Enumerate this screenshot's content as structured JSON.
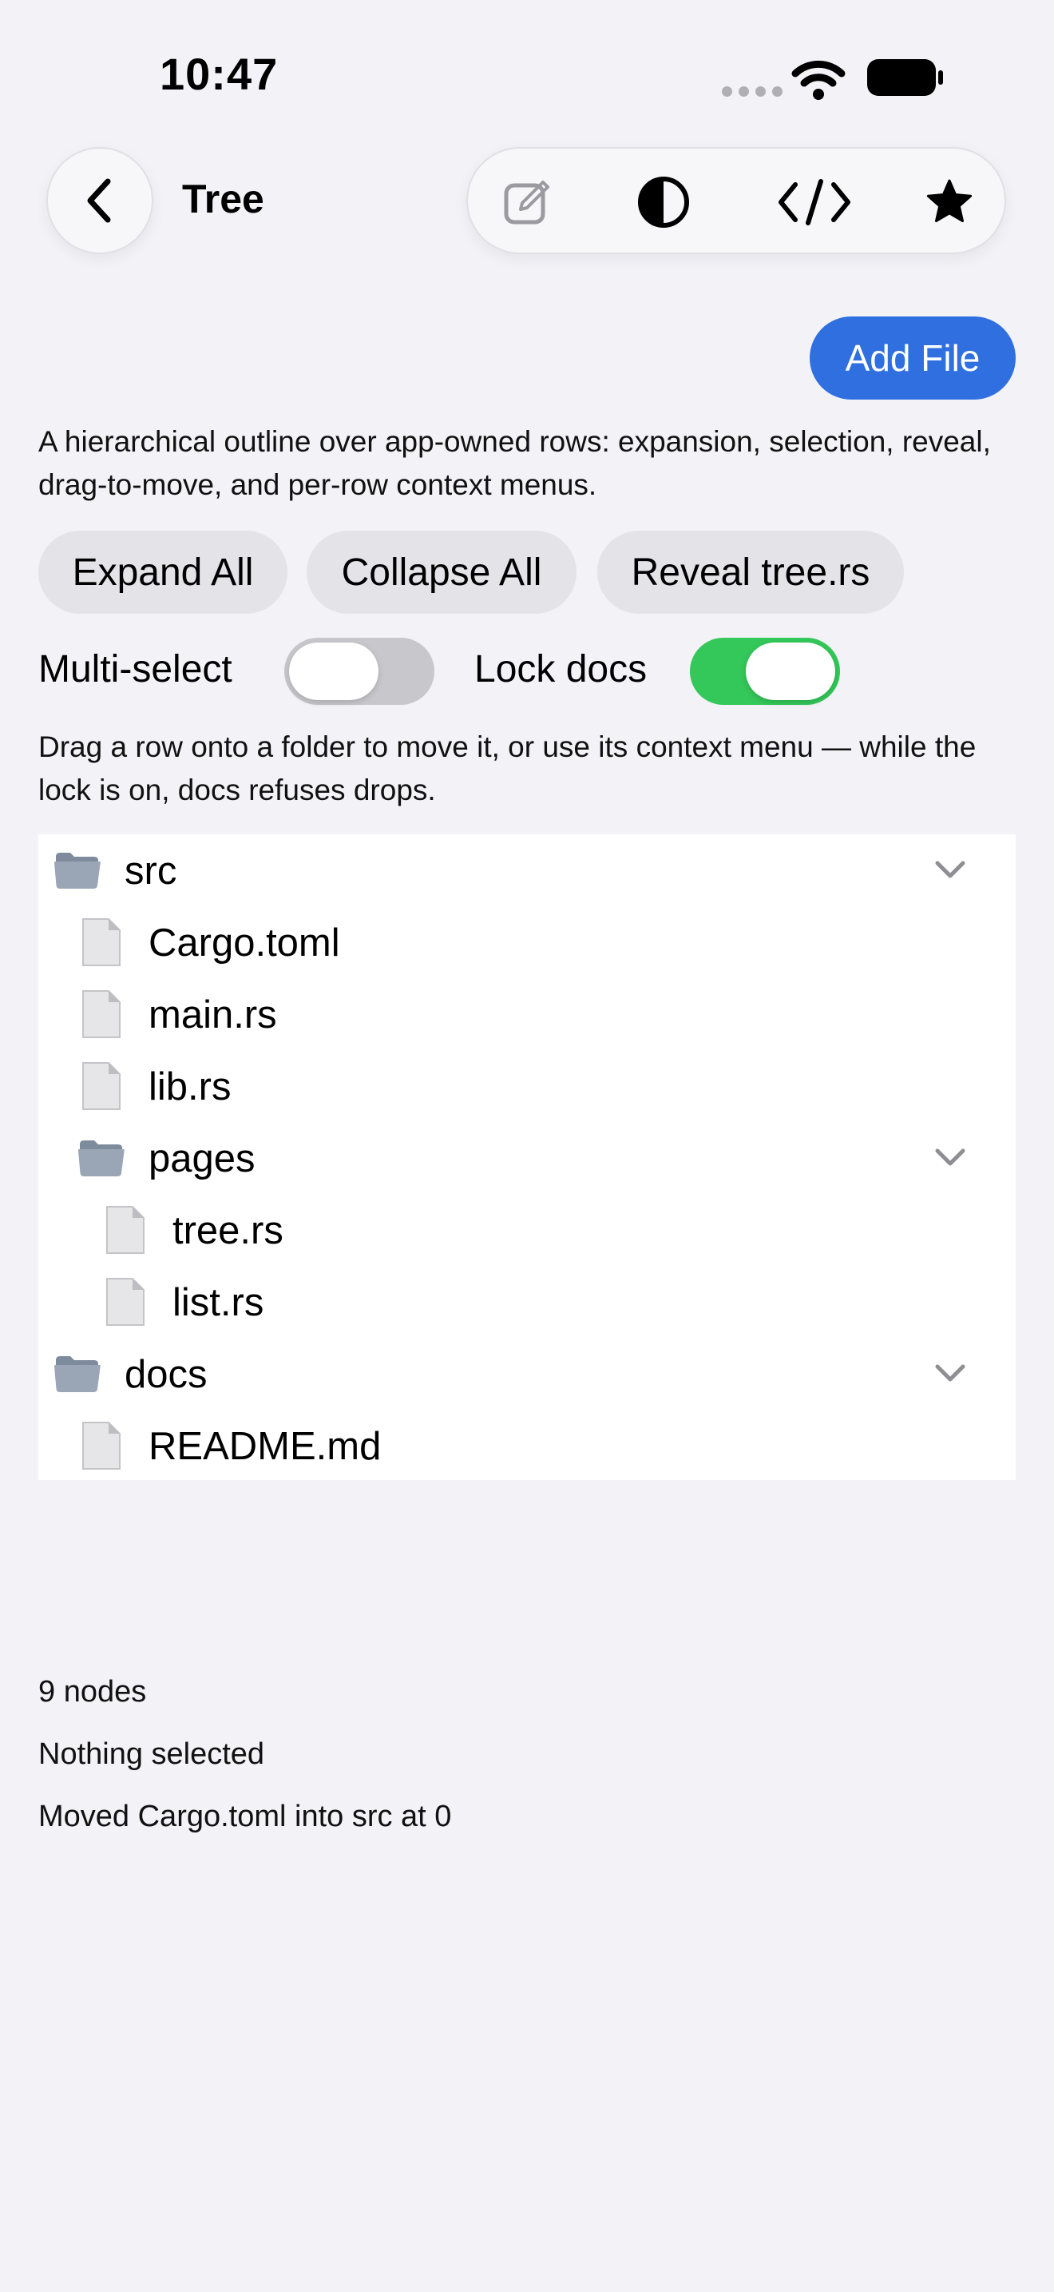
{
  "status_bar": {
    "time": "10:47"
  },
  "nav": {
    "title": "Tree",
    "back_icon": "chevron-left-icon",
    "toolbar_icons": [
      "edit-icon",
      "contrast-icon",
      "code-icon",
      "star-icon"
    ]
  },
  "add_file_label": "Add File",
  "description": "A hierarchical outline over app-owned rows: expansion, selection, reveal, drag-to-move, and per-row context menus.",
  "actions": {
    "expand_all": "Expand All",
    "collapse_all": "Collapse All",
    "reveal": "Reveal tree.rs"
  },
  "toggles": {
    "multi_select": {
      "label": "Multi-select",
      "on": false
    },
    "lock_docs": {
      "label": "Lock docs",
      "on": true
    }
  },
  "hint": "Drag a row onto a folder to move it, or use its context menu — while the lock is on, docs refuses drops.",
  "tree": [
    {
      "label": "src",
      "kind": "folder",
      "depth": 0,
      "expanded": true
    },
    {
      "label": "Cargo.toml",
      "kind": "file",
      "depth": 1
    },
    {
      "label": "main.rs",
      "kind": "file",
      "depth": 1
    },
    {
      "label": "lib.rs",
      "kind": "file",
      "depth": 1
    },
    {
      "label": "pages",
      "kind": "folder",
      "depth": 1,
      "expanded": true
    },
    {
      "label": "tree.rs",
      "kind": "file",
      "depth": 2
    },
    {
      "label": "list.rs",
      "kind": "file",
      "depth": 2
    },
    {
      "label": "docs",
      "kind": "folder",
      "depth": 0,
      "expanded": true
    },
    {
      "label": "README.md",
      "kind": "file",
      "depth": 1
    }
  ],
  "footer": {
    "node_count": "9 nodes",
    "selection": "Nothing selected",
    "last_action": "Moved Cargo.toml into src at 0"
  },
  "colors": {
    "accent": "#2f6fe0",
    "toggle_on": "#34c759",
    "toggle_off": "#c7c7cc",
    "background": "#f2f2f7"
  }
}
